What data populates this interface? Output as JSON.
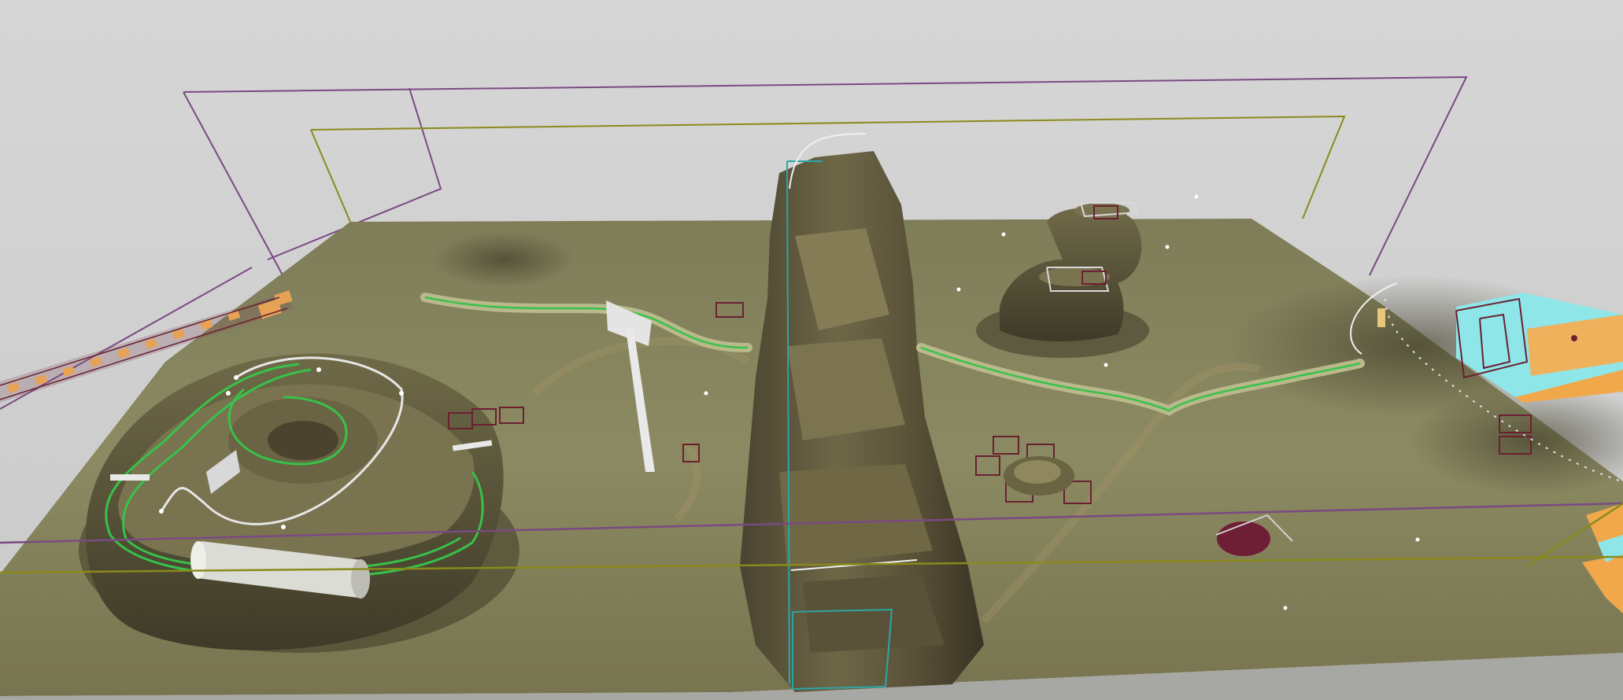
{
  "viewport": {
    "kind": "3d-level-editor-viewport",
    "text_elements": []
  },
  "colors": {
    "sky": "#d0d0d0",
    "ground_light": "#8b8b63",
    "ground_dark": "#5f5c40",
    "cliff_dark": "#3c3626",
    "cliff_mid": "#6b6447",
    "path_fill": "#b9b98c",
    "spline_green": "#37c24a",
    "bounds_purple": "#7a4a83",
    "bounds_yellow": "#8a8a1c",
    "trigger_maroon": "#6b2030",
    "teal_volume": "#2aa6a6",
    "cyan_block": "#8fe6e8",
    "orange_block": "#f0a84a",
    "white_mesh": "#e8e8e8"
  },
  "icons": [
    "terrain-landscape",
    "rock-cliff-ridge",
    "mesa-left",
    "mesa-top-right",
    "spline-path",
    "signpost-mesh",
    "tunnel-pipe-mesh",
    "bounds-box-purple",
    "bounds-box-yellow",
    "trigger-box",
    "cyan-building-block",
    "orange-stacked-props",
    "water-puddle-decal"
  ]
}
